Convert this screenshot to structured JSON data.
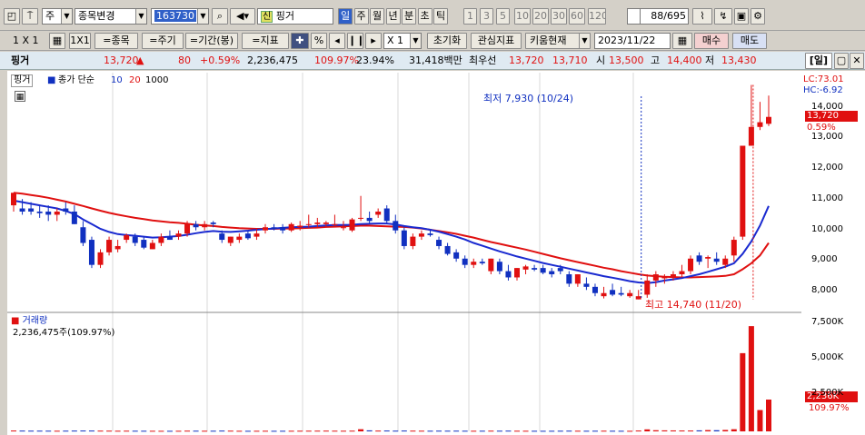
{
  "toolbar": {
    "period_unit": "주",
    "stock_change_label": "종목변경",
    "stock_code": "163730",
    "credit_badge": "신",
    "stock_name": "핑거",
    "period_tabs": [
      "일",
      "주",
      "월",
      "년",
      "분",
      "초",
      "틱"
    ],
    "active_period": "일",
    "minute_options": [
      "1",
      "3",
      "5",
      "10",
      "20",
      "30",
      "60",
      "120"
    ],
    "page_counter": "88",
    "page_total": "/695",
    "scale_label": "1 X 1",
    "grid_button": "1X1",
    "add_stock": "=종목",
    "add_cycle": "=주기",
    "add_period": "=기간(봉)",
    "add_indicator": "=지표",
    "percent_symbol": "%",
    "zoom_value": "X 1",
    "reset_button": "초기화",
    "watch_indicator_button": "관심지표",
    "kiwoom_button": "키움현재",
    "date_value": "2023/11/22",
    "buy_button": "매수",
    "sell_button": "매도"
  },
  "quote": {
    "name": "핑거",
    "price": "13,720",
    "change": "80",
    "change_pct": "+0.59%",
    "volume": "2,236,475",
    "volume_ratio": "109.97%",
    "turnover": "23.94%",
    "amount": "31,418백만",
    "best_ask_label": "최우선",
    "best_ask": "13,720",
    "best_bid": "13,710",
    "open_label": "시",
    "open": "13,500",
    "high_label": "고",
    "high": "14,400",
    "low_label": "저",
    "low": "13,430",
    "period_button": "[일]"
  },
  "price_panel": {
    "stock_tag": "핑거",
    "legend_text": "종가 단순",
    "ma_short": "10",
    "ma_long": "20",
    "ma_extra": "1000",
    "lc": "LC:73.01",
    "hc": "HC:-6.92",
    "low_note": "최저 7,930 (10/24)",
    "high_note": "최고 14,740 (11/20)",
    "price_tag": "13,720",
    "pct_tag": "0.59%",
    "y_ticks": [
      "14,000",
      "13,000",
      "12,000",
      "11,000",
      "10,000",
      "9,000",
      "8,000"
    ]
  },
  "volume_panel": {
    "title": "거래량",
    "value_text": "2,236,475주(109.97%)",
    "tag_value": "2,236K",
    "tag_pct": "109.97%",
    "y_ticks": [
      "7,500K",
      "5,000K",
      "2,500K"
    ]
  },
  "colors": {
    "up": "#e01010",
    "down": "#1030c0",
    "ma10": "#1a2ad0",
    "ma20": "#e01010"
  },
  "chart_data": {
    "type": "candlestick",
    "ylim": [
      7600,
      14900
    ],
    "candles": [
      {
        "o": 10900,
        "h": 11300,
        "l": 10700,
        "c": 11300
      },
      {
        "o": 10800,
        "h": 11100,
        "l": 10600,
        "c": 10700
      },
      {
        "o": 10800,
        "h": 11000,
        "l": 10600,
        "c": 10700
      },
      {
        "o": 10700,
        "h": 10900,
        "l": 10500,
        "c": 10650
      },
      {
        "o": 10700,
        "h": 10900,
        "l": 10400,
        "c": 10600
      },
      {
        "o": 10600,
        "h": 10800,
        "l": 10400,
        "c": 10700
      },
      {
        "o": 10800,
        "h": 11000,
        "l": 10600,
        "c": 10700
      },
      {
        "o": 10700,
        "h": 10900,
        "l": 10300,
        "c": 10300
      },
      {
        "o": 10200,
        "h": 10400,
        "l": 9600,
        "c": 9700
      },
      {
        "o": 9800,
        "h": 9900,
        "l": 8900,
        "c": 9000
      },
      {
        "o": 9000,
        "h": 9500,
        "l": 8900,
        "c": 9400
      },
      {
        "o": 9400,
        "h": 9900,
        "l": 9300,
        "c": 9800
      },
      {
        "o": 9500,
        "h": 9800,
        "l": 9400,
        "c": 9600
      },
      {
        "o": 9800,
        "h": 10000,
        "l": 9700,
        "c": 9950
      },
      {
        "o": 9900,
        "h": 10000,
        "l": 9600,
        "c": 9700
      },
      {
        "o": 9800,
        "h": 9900,
        "l": 9500,
        "c": 9550
      },
      {
        "o": 9500,
        "h": 9800,
        "l": 9500,
        "c": 9700
      },
      {
        "o": 9700,
        "h": 10000,
        "l": 9600,
        "c": 9900
      },
      {
        "o": 9900,
        "h": 10100,
        "l": 9800,
        "c": 9800
      },
      {
        "o": 9900,
        "h": 10100,
        "l": 9800,
        "c": 10000
      },
      {
        "o": 10000,
        "h": 10400,
        "l": 9900,
        "c": 10300
      },
      {
        "o": 10300,
        "h": 10400,
        "l": 10100,
        "c": 10200
      },
      {
        "o": 10200,
        "h": 10400,
        "l": 10100,
        "c": 10300
      },
      {
        "o": 10350,
        "h": 10400,
        "l": 10200,
        "c": 10300
      },
      {
        "o": 10000,
        "h": 10100,
        "l": 9700,
        "c": 9800
      },
      {
        "o": 9700,
        "h": 9900,
        "l": 9600,
        "c": 9900
      },
      {
        "o": 9800,
        "h": 10000,
        "l": 9700,
        "c": 9900
      },
      {
        "o": 10000,
        "h": 10100,
        "l": 9800,
        "c": 9850
      },
      {
        "o": 9900,
        "h": 10150,
        "l": 9800,
        "c": 10000
      },
      {
        "o": 10100,
        "h": 10300,
        "l": 10000,
        "c": 10200
      },
      {
        "o": 10200,
        "h": 10300,
        "l": 10100,
        "c": 10150
      },
      {
        "o": 10200,
        "h": 10300,
        "l": 10000,
        "c": 10100
      },
      {
        "o": 10100,
        "h": 10350,
        "l": 10050,
        "c": 10300
      },
      {
        "o": 10200,
        "h": 10400,
        "l": 10100,
        "c": 10250
      },
      {
        "o": 10300,
        "h": 10600,
        "l": 10200,
        "c": 10300
      },
      {
        "o": 10300,
        "h": 10500,
        "l": 10200,
        "c": 10350
      },
      {
        "o": 10300,
        "h": 10400,
        "l": 10200,
        "c": 10350
      },
      {
        "o": 10300,
        "h": 10600,
        "l": 10200,
        "c": 10300
      },
      {
        "o": 10200,
        "h": 10400,
        "l": 10100,
        "c": 10200
      },
      {
        "o": 10100,
        "h": 10500,
        "l": 10050,
        "c": 10450
      },
      {
        "o": 10500,
        "h": 11200,
        "l": 10400,
        "c": 10500
      },
      {
        "o": 10500,
        "h": 10700,
        "l": 10300,
        "c": 10400
      },
      {
        "o": 10600,
        "h": 10800,
        "l": 10500,
        "c": 10700
      },
      {
        "o": 10800,
        "h": 10900,
        "l": 10300,
        "c": 10400
      },
      {
        "o": 10400,
        "h": 10600,
        "l": 10000,
        "c": 10100
      },
      {
        "o": 10100,
        "h": 10200,
        "l": 9500,
        "c": 9600
      },
      {
        "o": 9600,
        "h": 10000,
        "l": 9500,
        "c": 9900
      },
      {
        "o": 9900,
        "h": 10100,
        "l": 9800,
        "c": 10000
      },
      {
        "o": 10000,
        "h": 10100,
        "l": 9900,
        "c": 9950
      },
      {
        "o": 9800,
        "h": 9900,
        "l": 9500,
        "c": 9600
      },
      {
        "o": 9600,
        "h": 9700,
        "l": 9300,
        "c": 9350
      },
      {
        "o": 9400,
        "h": 9500,
        "l": 9100,
        "c": 9200
      },
      {
        "o": 9200,
        "h": 9300,
        "l": 8900,
        "c": 9000
      },
      {
        "o": 9000,
        "h": 9200,
        "l": 8900,
        "c": 9100
      },
      {
        "o": 9100,
        "h": 9200,
        "l": 9000,
        "c": 9050
      },
      {
        "o": 8800,
        "h": 9200,
        "l": 8700,
        "c": 9200
      },
      {
        "o": 9100,
        "h": 9200,
        "l": 8700,
        "c": 8800
      },
      {
        "o": 8800,
        "h": 9000,
        "l": 8500,
        "c": 8600
      },
      {
        "o": 8600,
        "h": 8900,
        "l": 8500,
        "c": 8900
      },
      {
        "o": 8850,
        "h": 9000,
        "l": 8700,
        "c": 8950
      },
      {
        "o": 8900,
        "h": 9000,
        "l": 8800,
        "c": 8850
      },
      {
        "o": 8900,
        "h": 9000,
        "l": 8700,
        "c": 8750
      },
      {
        "o": 8800,
        "h": 8900,
        "l": 8600,
        "c": 8700
      },
      {
        "o": 8900,
        "h": 9000,
        "l": 8700,
        "c": 8800
      },
      {
        "o": 8700,
        "h": 8800,
        "l": 8300,
        "c": 8400
      },
      {
        "o": 8400,
        "h": 8700,
        "l": 8300,
        "c": 8700
      },
      {
        "o": 8400,
        "h": 8600,
        "l": 8200,
        "c": 8300
      },
      {
        "o": 8300,
        "h": 8400,
        "l": 8000,
        "c": 8100
      },
      {
        "o": 8000,
        "h": 8300,
        "l": 7930,
        "c": 8100
      },
      {
        "o": 8200,
        "h": 8400,
        "l": 8000,
        "c": 8050
      },
      {
        "o": 8100,
        "h": 8300,
        "l": 8000,
        "c": 8050
      },
      {
        "o": 8000,
        "h": 8200,
        "l": 7950,
        "c": 8100
      },
      {
        "o": 7900,
        "h": 8200,
        "l": 7900,
        "c": 8000
      },
      {
        "o": 8050,
        "h": 8700,
        "l": 7950,
        "c": 8500
      },
      {
        "o": 8500,
        "h": 8800,
        "l": 8300,
        "c": 8700
      },
      {
        "o": 8600,
        "h": 8700,
        "l": 8400,
        "c": 8600
      },
      {
        "o": 8600,
        "h": 8800,
        "l": 8500,
        "c": 8700
      },
      {
        "o": 8700,
        "h": 9000,
        "l": 8600,
        "c": 8800
      },
      {
        "o": 8800,
        "h": 9300,
        "l": 8700,
        "c": 9200
      },
      {
        "o": 9300,
        "h": 9400,
        "l": 9000,
        "c": 9100
      },
      {
        "o": 9200,
        "h": 9300,
        "l": 8900,
        "c": 9250
      },
      {
        "o": 9200,
        "h": 9400,
        "l": 9000,
        "c": 9100
      },
      {
        "o": 9000,
        "h": 9300,
        "l": 8900,
        "c": 9200
      },
      {
        "o": 9300,
        "h": 9900,
        "l": 9100,
        "c": 9800
      },
      {
        "o": 9900,
        "h": 12800,
        "l": 9800,
        "c": 12800
      },
      {
        "o": 12800,
        "h": 14740,
        "l": 12800,
        "c": 13400
      },
      {
        "o": 13400,
        "h": 14200,
        "l": 13300,
        "c": 13550
      },
      {
        "o": 13500,
        "h": 14400,
        "l": 13430,
        "c": 13720
      }
    ],
    "ma10": [
      11050,
      11000,
      10950,
      10900,
      10850,
      10800,
      10720,
      10620,
      10450,
      10300,
      10150,
      10050,
      9980,
      9950,
      9930,
      9900,
      9870,
      9880,
      9900,
      9920,
      9960,
      10010,
      10050,
      10080,
      10060,
      10050,
      10070,
      10090,
      10120,
      10140,
      10160,
      10180,
      10200,
      10210,
      10220,
      10240,
      10260,
      10270,
      10270,
      10280,
      10300,
      10310,
      10320,
      10320,
      10290,
      10240,
      10200,
      10170,
      10120,
      10060,
      9980,
      9900,
      9810,
      9700,
      9610,
      9520,
      9430,
      9350,
      9270,
      9200,
      9130,
      9060,
      9000,
      8940,
      8880,
      8820,
      8760,
      8700,
      8640,
      8590,
      8540,
      8480,
      8440,
      8420,
      8450,
      8500,
      8540,
      8580,
      8640,
      8700,
      8780,
      8860,
      8940,
      9050,
      9350,
      9750,
      10250,
      10880
    ],
    "ma20": [
      11300,
      11270,
      11230,
      11190,
      11140,
      11080,
      11020,
      10950,
      10880,
      10800,
      10730,
      10660,
      10600,
      10550,
      10500,
      10460,
      10420,
      10390,
      10360,
      10340,
      10310,
      10280,
      10260,
      10240,
      10210,
      10190,
      10170,
      10160,
      10150,
      10150,
      10150,
      10160,
      10160,
      10170,
      10180,
      10190,
      10210,
      10220,
      10230,
      10240,
      10250,
      10250,
      10240,
      10230,
      10220,
      10210,
      10190,
      10160,
      10120,
      10080,
      10040,
      9990,
      9930,
      9870,
      9800,
      9730,
      9670,
      9610,
      9550,
      9490,
      9420,
      9350,
      9280,
      9210,
      9150,
      9090,
      9030,
      8970,
      8910,
      8860,
      8800,
      8750,
      8700,
      8660,
      8640,
      8620,
      8610,
      8600,
      8600,
      8610,
      8620,
      8630,
      8650,
      8700,
      8860,
      9050,
      9300,
      9700
    ],
    "volume": [
      60,
      55,
      50,
      50,
      48,
      45,
      50,
      55,
      60,
      58,
      52,
      50,
      45,
      48,
      46,
      44,
      42,
      40,
      40,
      42,
      50,
      48,
      44,
      46,
      55,
      50,
      42,
      40,
      42,
      44,
      40,
      42,
      44,
      46,
      48,
      50,
      52,
      48,
      46,
      50,
      150,
      70,
      55,
      60,
      50,
      58,
      52,
      48,
      46,
      50,
      48,
      50,
      46,
      44,
      46,
      50,
      48,
      52,
      46,
      44,
      42,
      40,
      42,
      46,
      50,
      46,
      44,
      46,
      48,
      44,
      42,
      40,
      60,
      140,
      80,
      70,
      66,
      62,
      60,
      70,
      90,
      80,
      100,
      150,
      5500,
      7400,
      1500,
      2236
    ]
  }
}
